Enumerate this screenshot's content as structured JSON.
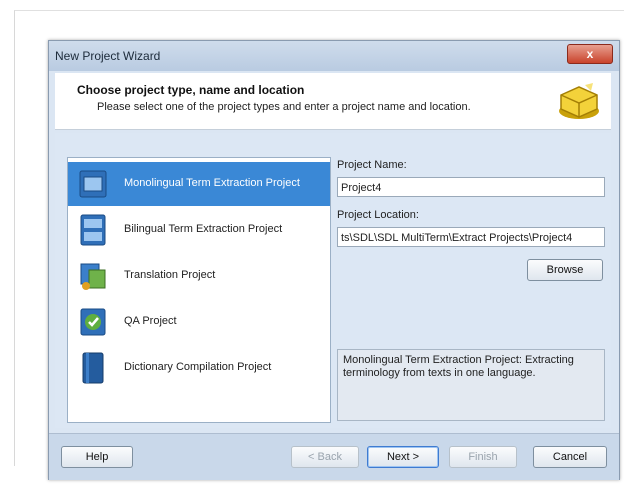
{
  "window": {
    "title": "New Project Wizard",
    "close_label": "x"
  },
  "header": {
    "title": "Choose project type, name and location",
    "subtitle": "Please select one of the project types and enter a project name and location.",
    "icon": "wizard-icon"
  },
  "project_types": [
    {
      "label": "Monolingual Term Extraction Project",
      "icon": "monolingual-icon",
      "selected": true
    },
    {
      "label": "Bilingual Term Extraction Project",
      "icon": "bilingual-icon",
      "selected": false
    },
    {
      "label": "Translation Project",
      "icon": "translation-icon",
      "selected": false
    },
    {
      "label": "QA Project",
      "icon": "qa-icon",
      "selected": false
    },
    {
      "label": "Dictionary Compilation Project",
      "icon": "dictionary-icon",
      "selected": false
    }
  ],
  "form": {
    "name_label": "Project Name:",
    "name_value": "Project4",
    "location_label": "Project Location:",
    "location_value": "ts\\SDL\\SDL MultiTerm\\Extract Projects\\Project4",
    "browse_label": "Browse",
    "description": "Monolingual Term Extraction Project: Extracting terminology from texts in one language."
  },
  "buttons": {
    "help": "Help",
    "back": "< Back",
    "next": "Next >",
    "finish": "Finish",
    "cancel": "Cancel"
  },
  "colors": {
    "selection": "#3a88d6",
    "dialog_bg": "#dbe6f3"
  }
}
